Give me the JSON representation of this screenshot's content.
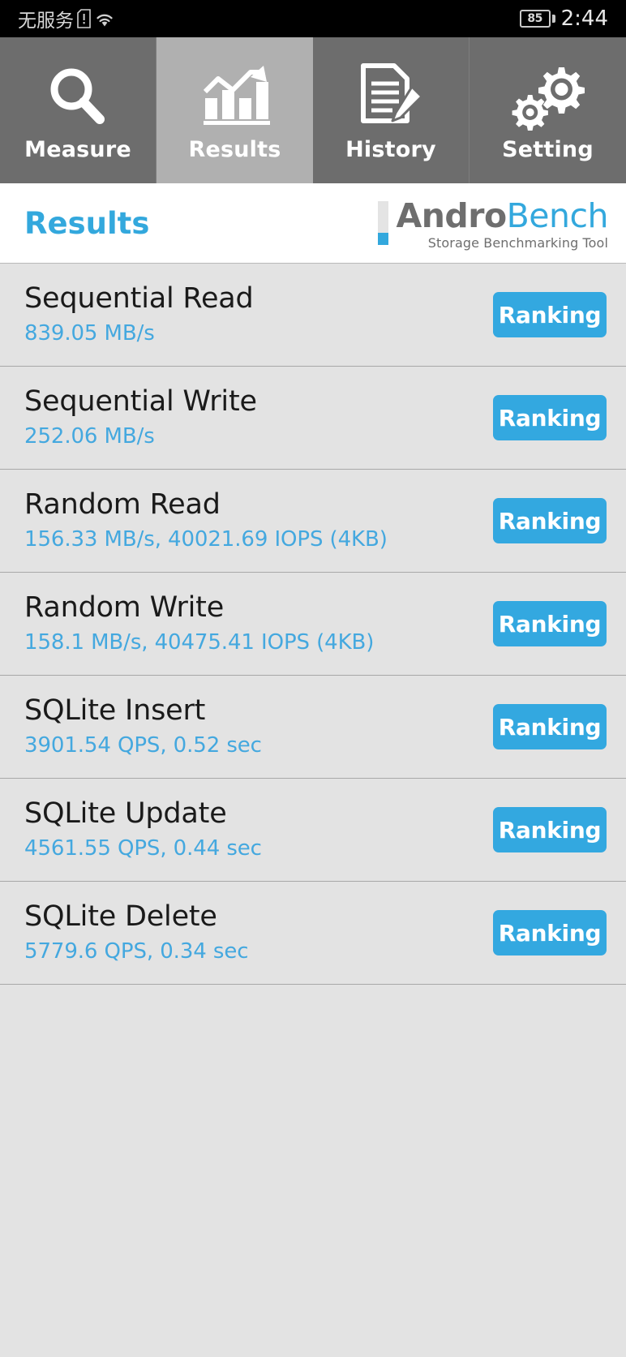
{
  "status_bar": {
    "carrier": "无服务",
    "sim_icon": "sim-alert-icon",
    "wifi_icon": "wifi-icon",
    "battery_level": "85",
    "time": "2:44"
  },
  "tabs": [
    {
      "label": "Measure",
      "icon": "magnifier-icon",
      "active": false
    },
    {
      "label": "Results",
      "icon": "bar-chart-trend-icon",
      "active": true
    },
    {
      "label": "History",
      "icon": "document-pencil-icon",
      "active": false
    },
    {
      "label": "Setting",
      "icon": "gears-icon",
      "active": false
    }
  ],
  "header": {
    "title": "Results",
    "brand_first": "Andro",
    "brand_second": "Bench",
    "brand_subtitle": "Storage Benchmarking Tool"
  },
  "results": [
    {
      "title": "Sequential Read",
      "value": "839.05 MB/s",
      "button": "Ranking"
    },
    {
      "title": "Sequential Write",
      "value": "252.06 MB/s",
      "button": "Ranking"
    },
    {
      "title": "Random Read",
      "value": "156.33 MB/s, 40021.69 IOPS (4KB)",
      "button": "Ranking"
    },
    {
      "title": "Random Write",
      "value": "158.1 MB/s, 40475.41 IOPS (4KB)",
      "button": "Ranking"
    },
    {
      "title": "SQLite Insert",
      "value": "3901.54 QPS, 0.52 sec",
      "button": "Ranking"
    },
    {
      "title": "SQLite Update",
      "value": "4561.55 QPS, 0.44 sec",
      "button": "Ranking"
    },
    {
      "title": "SQLite Delete",
      "value": "5779.6 QPS, 0.34 sec",
      "button": "Ranking"
    }
  ],
  "colors": {
    "accent_blue": "#33a8dd",
    "value_blue": "#44a8df",
    "tab_inactive": "#6d6d6d",
    "tab_active": "#b0b0b0",
    "list_background": "#e3e3e3",
    "status_background": "#000000"
  }
}
